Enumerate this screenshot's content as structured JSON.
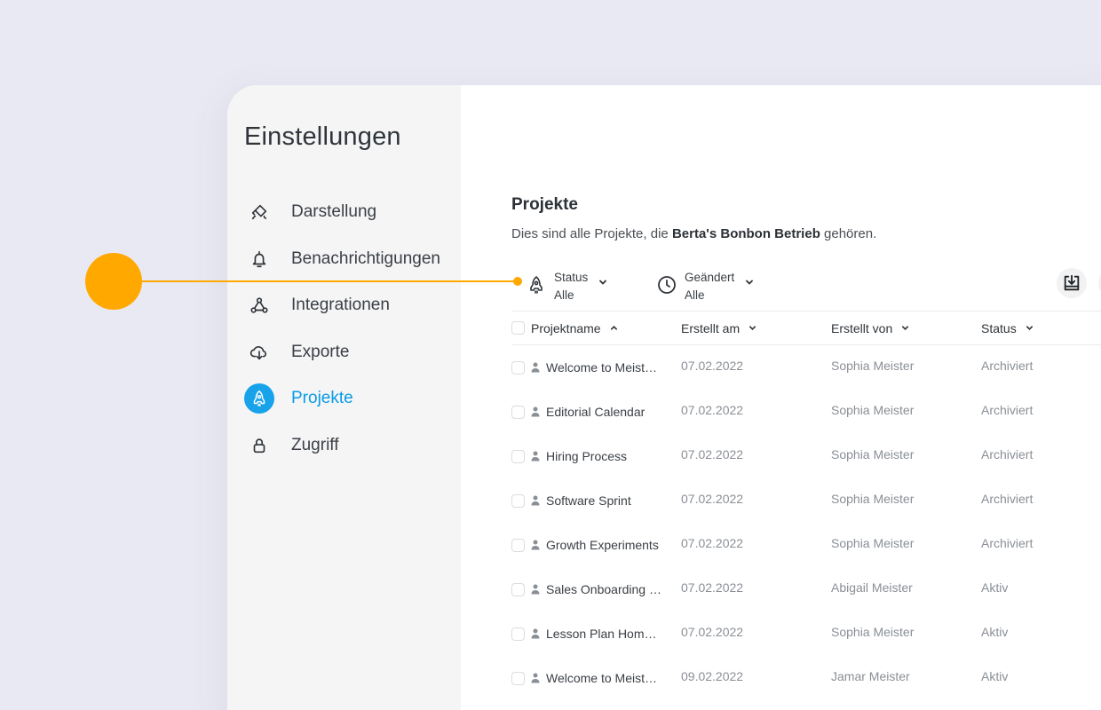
{
  "colors": {
    "accent": "#17a2ea",
    "callout": "#ffa800",
    "background": "#e9e9f3"
  },
  "sidebar": {
    "title": "Einstellungen",
    "items": [
      {
        "label": "Darstellung",
        "icon": "paint-icon",
        "active": false
      },
      {
        "label": "Benachrichtigungen",
        "icon": "bell-icon",
        "active": false
      },
      {
        "label": "Integrationen",
        "icon": "integrations-icon",
        "active": false
      },
      {
        "label": "Exporte",
        "icon": "cloud-download-icon",
        "active": false
      },
      {
        "label": "Projekte",
        "icon": "rocket-icon",
        "active": true
      },
      {
        "label": "Zugriff",
        "icon": "lock-icon",
        "active": false
      }
    ]
  },
  "main": {
    "title": "Projekte",
    "subtitle_prefix": "Dies sind alle Projekte, die ",
    "subtitle_owner": "Berta's Bonbon Betrieb",
    "subtitle_suffix": " gehören."
  },
  "filters": {
    "status": {
      "label": "Status",
      "value": "Alle",
      "icon": "rocket-icon"
    },
    "changed": {
      "label": "Geändert",
      "value": "Alle",
      "icon": "clock-icon"
    }
  },
  "table": {
    "columns": [
      "Projektname",
      "Erstellt am",
      "Erstellt von",
      "Status"
    ],
    "rows": [
      {
        "name": "Welcome to Meist…",
        "date": "07.02.2022",
        "creator": "Sophia Meister",
        "status": "Archiviert"
      },
      {
        "name": "Editorial Calendar",
        "date": "07.02.2022",
        "creator": "Sophia Meister",
        "status": "Archiviert"
      },
      {
        "name": "Hiring Process",
        "date": "07.02.2022",
        "creator": "Sophia Meister",
        "status": "Archiviert"
      },
      {
        "name": "Software Sprint",
        "date": "07.02.2022",
        "creator": "Sophia Meister",
        "status": "Archiviert"
      },
      {
        "name": "Growth Experiments",
        "date": "07.02.2022",
        "creator": "Sophia Meister",
        "status": "Archiviert"
      },
      {
        "name": "Sales Onboarding …",
        "date": "07.02.2022",
        "creator": "Abigail Meister",
        "status": "Aktiv"
      },
      {
        "name": "Lesson Plan Home…",
        "date": "07.02.2022",
        "creator": "Sophia Meister",
        "status": "Aktiv"
      },
      {
        "name": "Welcome to Meist…",
        "date": "09.02.2022",
        "creator": "Jamar Meister",
        "status": "Aktiv"
      }
    ]
  }
}
